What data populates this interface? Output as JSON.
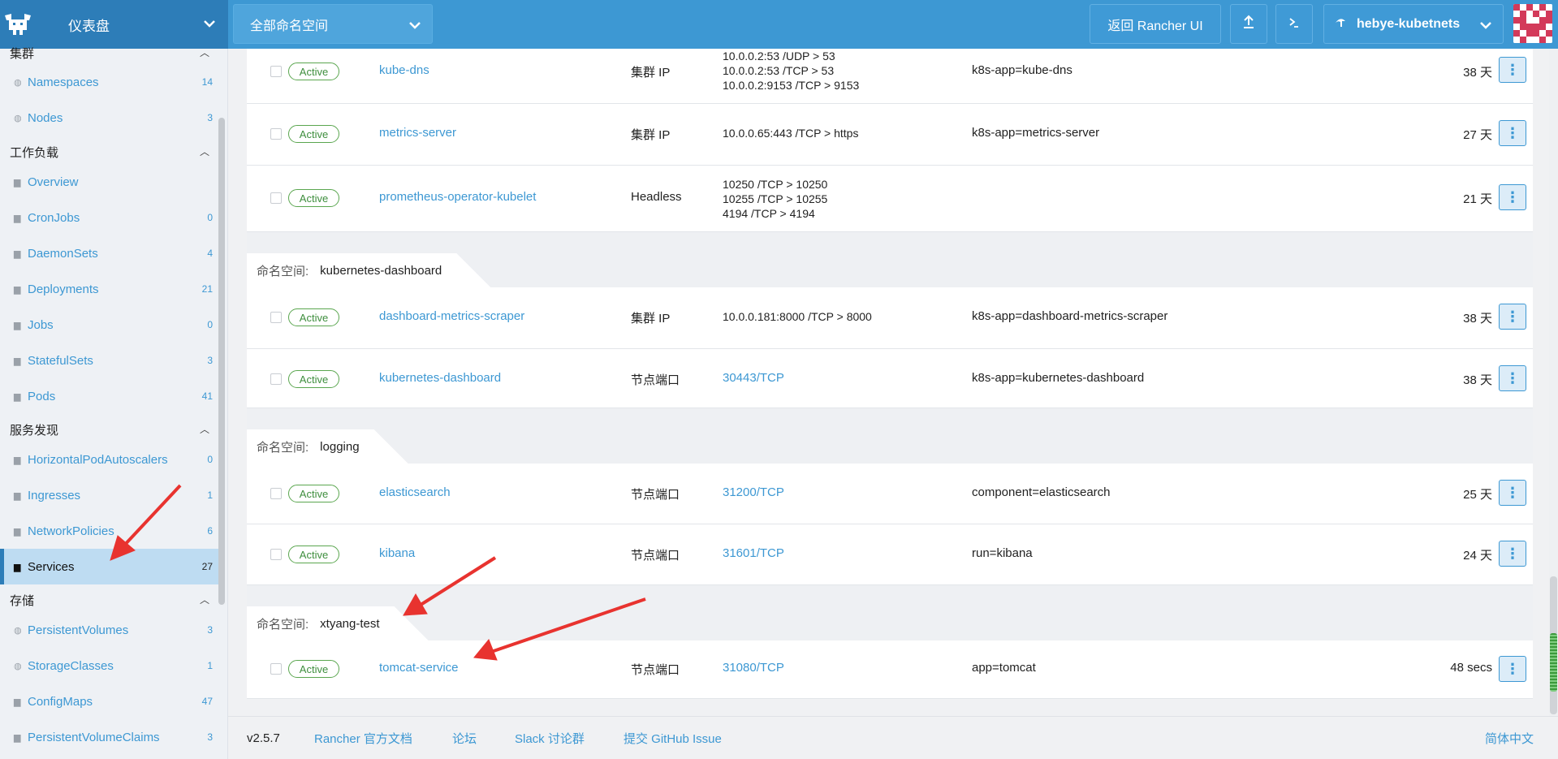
{
  "header": {
    "title": "仪表盘",
    "namespace_select": "全部命名空间",
    "return_button": "返回 Rancher UI",
    "cluster_name": "hebye-kubetnets",
    "colors": {
      "header_bg": "#3d98d3",
      "left_bg": "#2d7db8"
    }
  },
  "sidebar": {
    "groups": [
      {
        "label": "集群",
        "items": [
          {
            "label": "Namespaces",
            "count": "14",
            "icon": "namespace-icon"
          },
          {
            "label": "Nodes",
            "count": "3",
            "icon": "node-icon"
          }
        ]
      },
      {
        "label": "工作负载",
        "items": [
          {
            "label": "Overview",
            "count": "",
            "icon": "folder-icon"
          },
          {
            "label": "CronJobs",
            "count": "0",
            "icon": "folder-icon"
          },
          {
            "label": "DaemonSets",
            "count": "4",
            "icon": "folder-icon"
          },
          {
            "label": "Deployments",
            "count": "21",
            "icon": "folder-icon"
          },
          {
            "label": "Jobs",
            "count": "0",
            "icon": "folder-icon"
          },
          {
            "label": "StatefulSets",
            "count": "3",
            "icon": "folder-icon"
          },
          {
            "label": "Pods",
            "count": "41",
            "icon": "folder-icon"
          }
        ]
      },
      {
        "label": "服务发现",
        "items": [
          {
            "label": "HorizontalPodAutoscalers",
            "count": "0",
            "icon": "folder-icon"
          },
          {
            "label": "Ingresses",
            "count": "1",
            "icon": "folder-icon"
          },
          {
            "label": "NetworkPolicies",
            "count": "6",
            "icon": "folder-icon"
          },
          {
            "label": "Services",
            "count": "27",
            "icon": "folder-icon",
            "active": true
          }
        ]
      },
      {
        "label": "存储",
        "items": [
          {
            "label": "PersistentVolumes",
            "count": "3",
            "icon": "namespace-icon"
          },
          {
            "label": "StorageClasses",
            "count": "1",
            "icon": "namespace-icon"
          },
          {
            "label": "ConfigMaps",
            "count": "47",
            "icon": "folder-icon"
          },
          {
            "label": "PersistentVolumeClaims",
            "count": "3",
            "icon": "folder-icon"
          }
        ]
      }
    ]
  },
  "table": {
    "namespace_label": "命名空间:",
    "rows_top": [
      {
        "state": "Active",
        "name": "kube-dns",
        "type": "集群 IP",
        "ports": [
          "10.0.0.2:53 /UDP > 53",
          "10.0.0.2:53 /TCP > 53",
          "10.0.0.2:9153 /TCP > 9153"
        ],
        "selector": "k8s-app=kube-dns",
        "age": "38 天"
      },
      {
        "state": "Active",
        "name": "metrics-server",
        "type": "集群 IP",
        "ports": [
          "10.0.0.65:443 /TCP > https"
        ],
        "selector": "k8s-app=metrics-server",
        "age": "27 天"
      },
      {
        "state": "Active",
        "name": "prometheus-operator-kubelet",
        "type": "Headless",
        "ports": [
          "10250 /TCP > 10250",
          "10255 /TCP > 10255",
          "4194 /TCP > 4194"
        ],
        "selector": "",
        "age": "21 天"
      }
    ],
    "groups": [
      {
        "namespace": "kubernetes-dashboard",
        "rows": [
          {
            "state": "Active",
            "name": "dashboard-metrics-scraper",
            "type": "集群 IP",
            "ports": [
              "10.0.0.181:8000 /TCP > 8000"
            ],
            "port_link": false,
            "selector": "k8s-app=dashboard-metrics-scraper",
            "age": "38 天"
          },
          {
            "state": "Active",
            "name": "kubernetes-dashboard",
            "type": "节点端口",
            "ports": [
              "30443/TCP"
            ],
            "port_link": true,
            "selector": "k8s-app=kubernetes-dashboard",
            "age": "38 天"
          }
        ]
      },
      {
        "namespace": "logging",
        "rows": [
          {
            "state": "Active",
            "name": "elasticsearch",
            "type": "节点端口",
            "ports": [
              "31200/TCP"
            ],
            "port_link": true,
            "selector": "component=elasticsearch",
            "age": "25 天"
          },
          {
            "state": "Active",
            "name": "kibana",
            "type": "节点端口",
            "ports": [
              "31601/TCP"
            ],
            "port_link": true,
            "selector": "run=kibana",
            "age": "24 天"
          }
        ]
      },
      {
        "namespace": "xtyang-test",
        "rows": [
          {
            "state": "Active",
            "name": "tomcat-service",
            "type": "节点端口",
            "ports": [
              "31080/TCP"
            ],
            "port_link": true,
            "selector": "app=tomcat",
            "age": "48 secs"
          }
        ]
      }
    ]
  },
  "footer": {
    "version": "v2.5.7",
    "links": [
      "Rancher 官方文档",
      "论坛",
      "Slack 讨论群",
      "提交 GitHub Issue"
    ],
    "language": "简体中文"
  }
}
